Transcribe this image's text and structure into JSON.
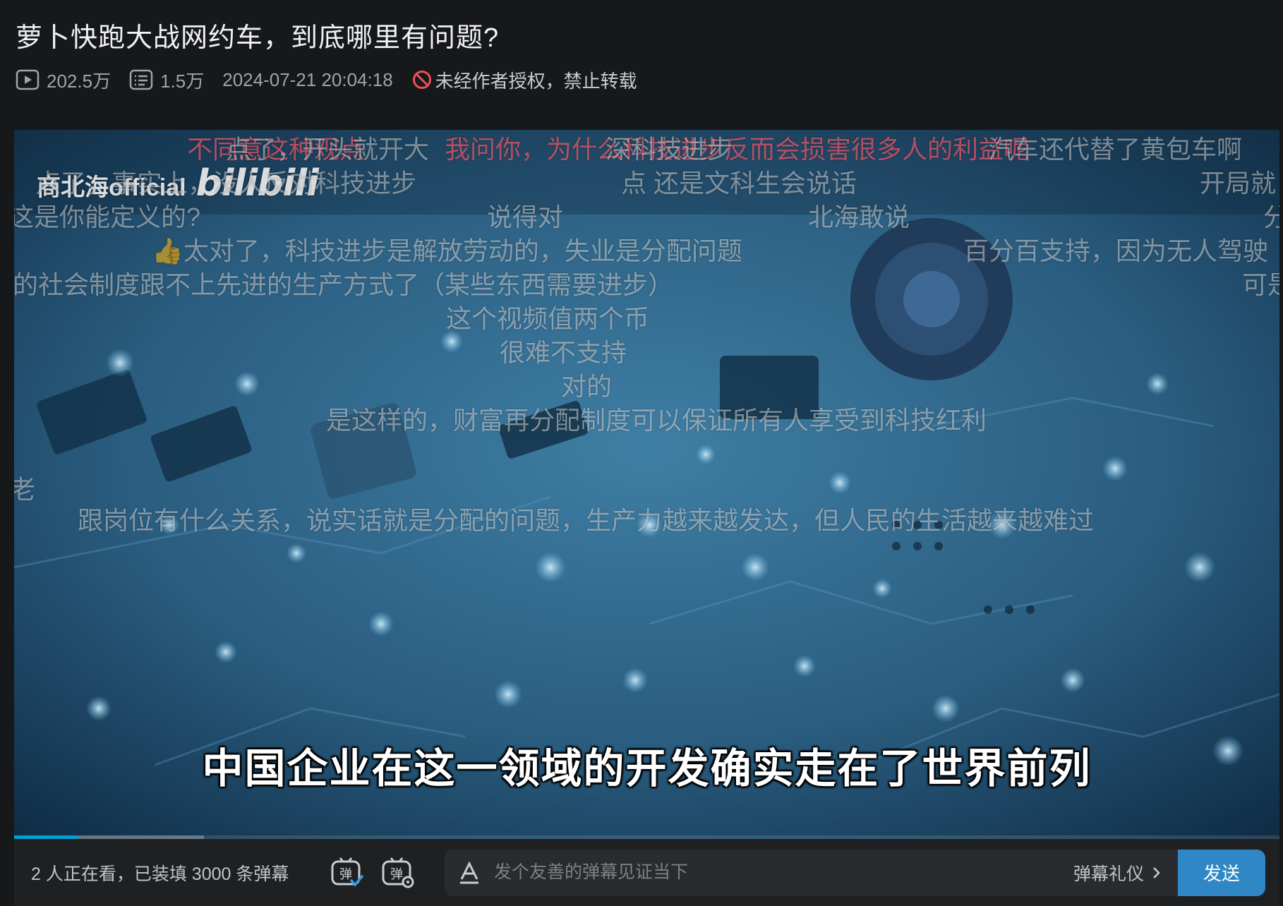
{
  "video": {
    "title": "萝卜快跑大战网约车，到底哪里有问题?",
    "views": "202.5万",
    "danmaku_count": "1.5万",
    "publish_time": "2024-07-21 20:04:18",
    "copyright_notice": "未经作者授权，禁止转载"
  },
  "player": {
    "watermark": "商北海official",
    "watermark_logo": "bilibili",
    "subtitle": "中国企业在这一领域的开发确实走在了世界前列",
    "progress": 0.05,
    "danmaku": [
      {
        "text": "不同意这种观点",
        "color": "red"
      },
      {
        "text": "点了，开头就开大",
        "color": "white"
      },
      {
        "text": "我问你，为什么科技进步反而会损害很多人的利益呢",
        "color": "red"
      },
      {
        "text": "深科技进步",
        "color": "white"
      },
      {
        "text": "汽车还代替了黄包车啊",
        "color": "white"
      },
      {
        "text": "点了，事实上，没人反对科技进步",
        "color": "white"
      },
      {
        "text": "点 还是文科生会说话",
        "color": "white"
      },
      {
        "text": "开局就",
        "color": "white"
      },
      {
        "text": "这是你能定义的?",
        "color": "white"
      },
      {
        "text": "说得对",
        "color": "white"
      },
      {
        "text": "北海敢说",
        "color": "white"
      },
      {
        "text": "分",
        "color": "white"
      },
      {
        "text": "太对了，科技进步是解放劳动的，失业是分配问题",
        "color": "white"
      },
      {
        "text": "百分百支持，因为无人驾驶",
        "color": "white"
      },
      {
        "text": "的社会制度跟不上先进的生产方式了（某些东西需要进步）",
        "color": "white"
      },
      {
        "text": "可是",
        "color": "white"
      },
      {
        "text": "这个视频值两个币",
        "color": "white"
      },
      {
        "text": "很难不支持",
        "color": "white"
      },
      {
        "text": "对的",
        "color": "white"
      },
      {
        "text": "是这样的，财富再分配制度可以保证所有人享受到科技红利",
        "color": "white"
      },
      {
        "text": "老",
        "color": "white"
      },
      {
        "text": "跟岗位有什么关系，说实话就是分配的问题，生产力越来越发达，但人民的生活越来越难过",
        "color": "white"
      }
    ]
  },
  "bottom_bar": {
    "viewers_text": "2 人正在看，已装填 3000 条弹幕",
    "input_placeholder": "发个友善的弹幕见证当下",
    "etiquette_label": "弹幕礼仪",
    "send_label": "发送"
  },
  "colors": {
    "background": "#17181a",
    "accent": "#00a1d6",
    "send_button": "#2f87c6",
    "warning_red": "#f04f5a"
  }
}
